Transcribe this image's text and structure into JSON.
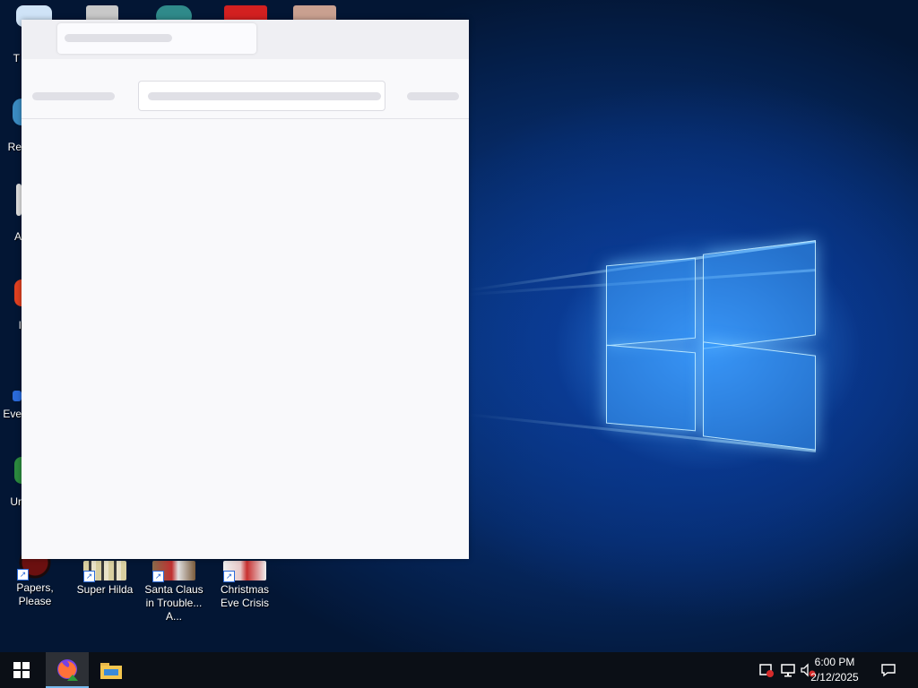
{
  "desktop": {
    "icons": [
      {
        "label": "Papers, Please"
      },
      {
        "label": "Super Hilda"
      },
      {
        "label": "Santa Claus in Trouble... A..."
      },
      {
        "label": "Christmas Eve Crisis"
      }
    ],
    "partial_labels": [
      "T",
      "Re",
      "A",
      "I",
      "Eve",
      "Ur"
    ]
  },
  "browser": {
    "state": "loading"
  },
  "taskbar": {
    "time": "6:00 PM",
    "date": "2/12/2025"
  },
  "colors": {
    "wallpaper": "#0b3f8f",
    "taskbar": "#0b0f16",
    "window_bg": "#f9f9fb",
    "accent": "#76b9ed"
  }
}
